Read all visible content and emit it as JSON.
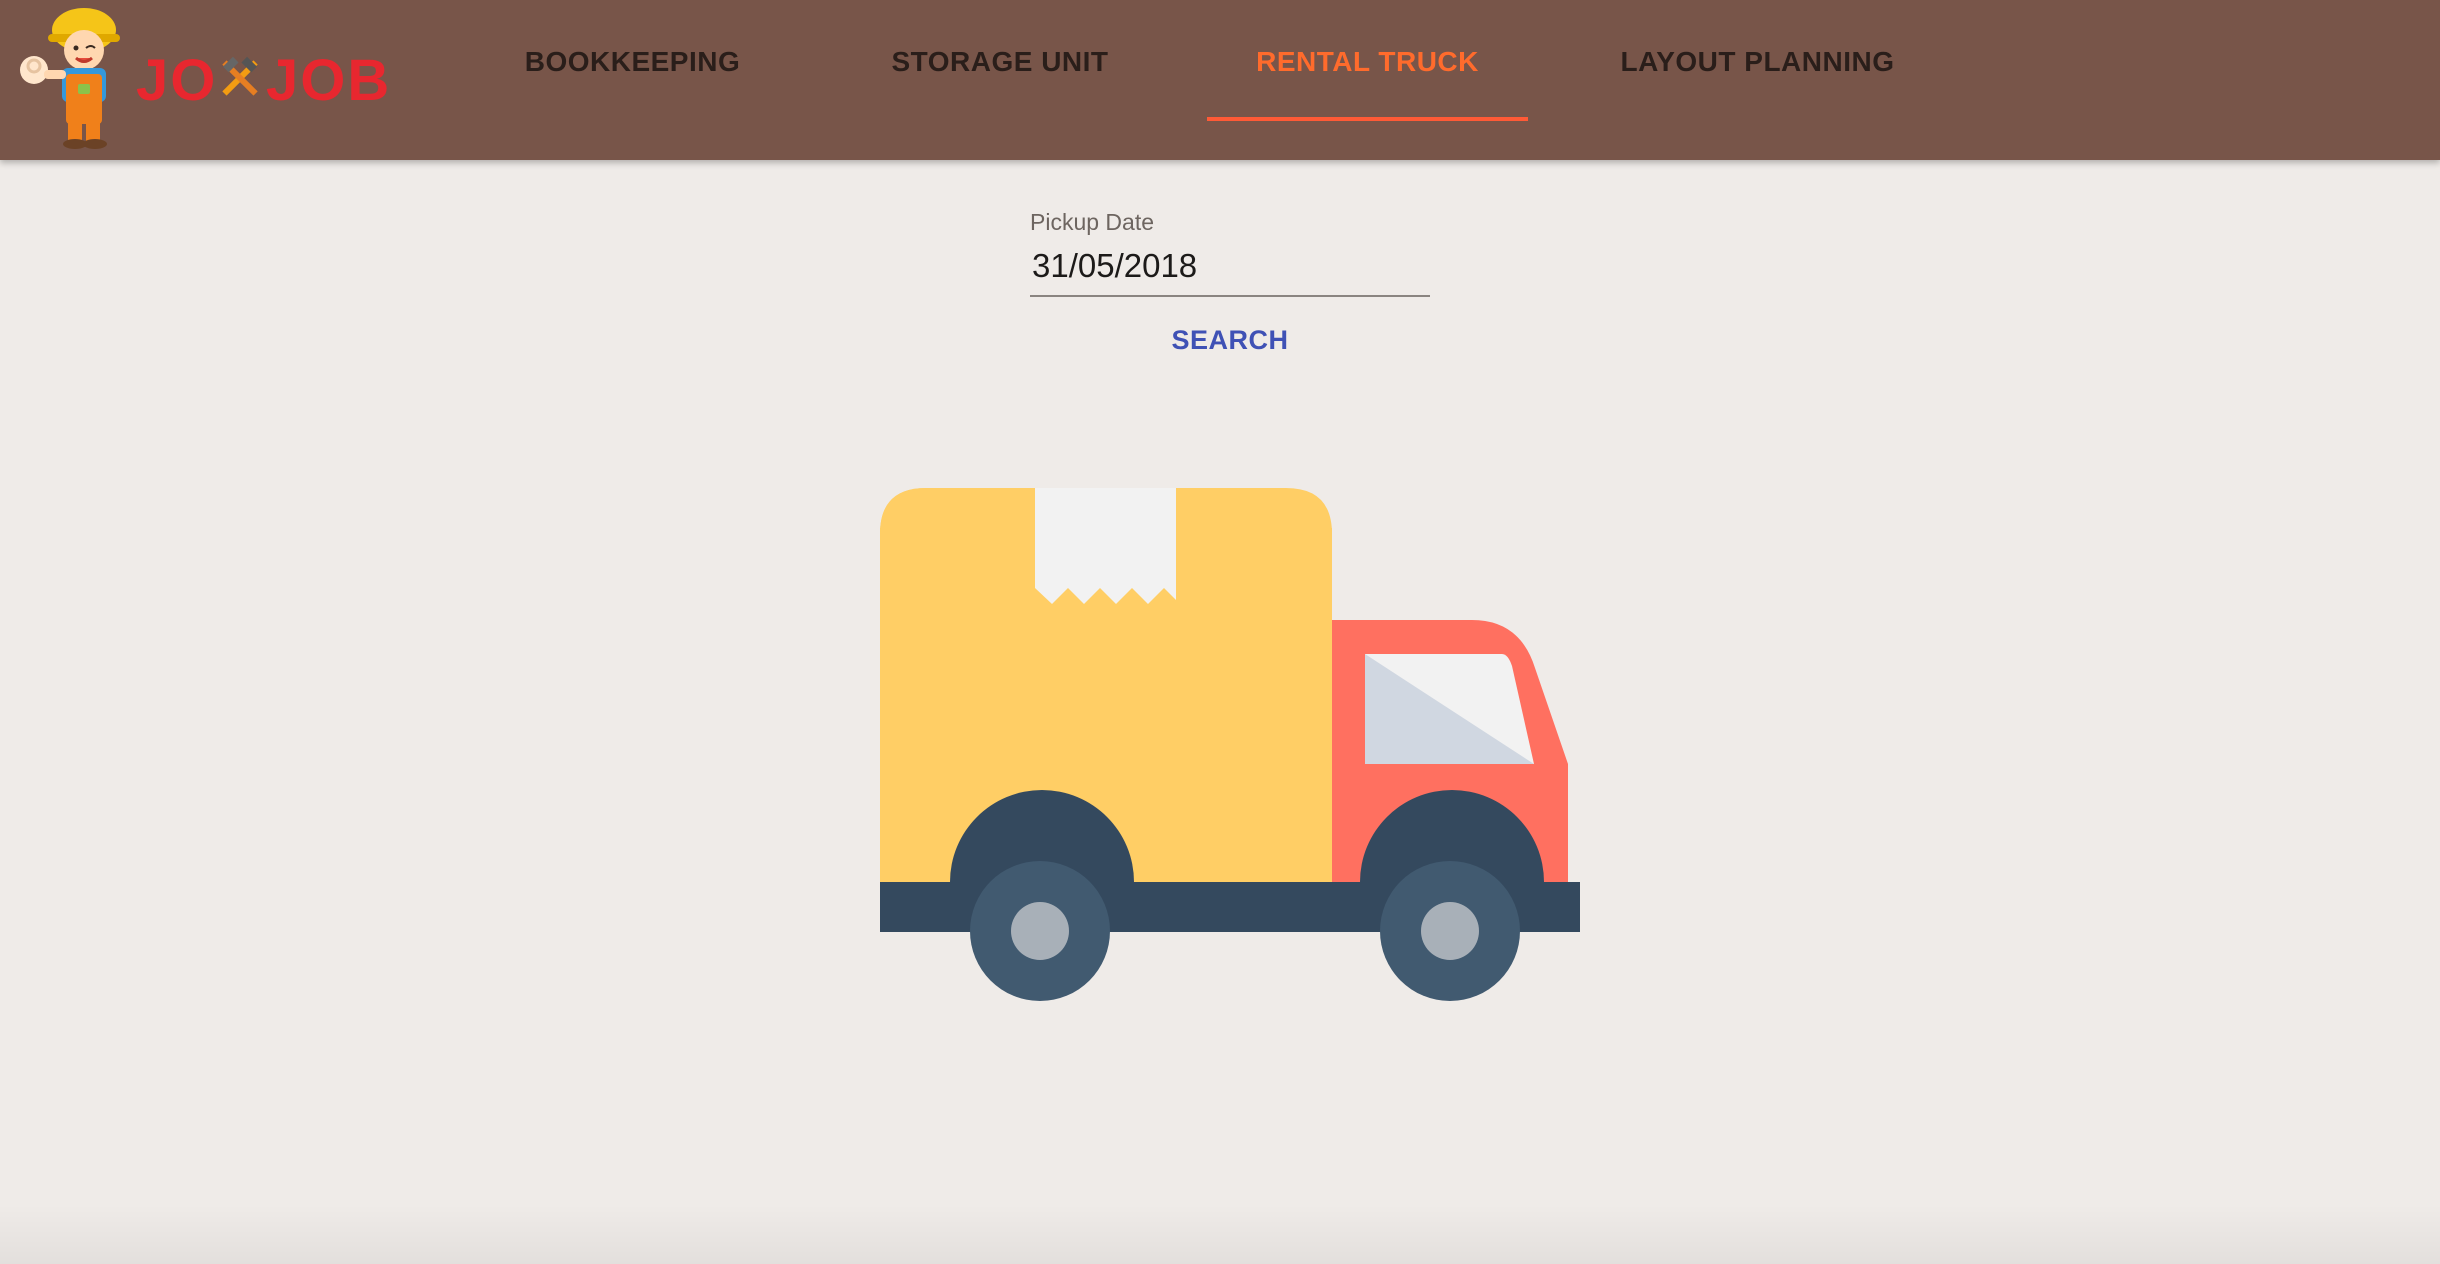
{
  "header": {
    "logo_text": "JO JOB",
    "tabs": [
      {
        "label": "BOOKKEEPING",
        "active": false
      },
      {
        "label": "STORAGE UNIT",
        "active": false
      },
      {
        "label": "RENTAL TRUCK",
        "active": true
      },
      {
        "label": "LAYOUT PLANNING",
        "active": false
      }
    ]
  },
  "form": {
    "pickup_date_label": "Pickup Date",
    "pickup_date_value": "31/05/2018",
    "search_label": "SEARCH"
  },
  "illustration": {
    "icon": "delivery-truck-icon"
  },
  "colors": {
    "appbar": "#785549",
    "background": "#efebe8",
    "active_tab": "#ff6b2c",
    "tab_indicator": "#ff5a36",
    "search_button": "#3f51b5",
    "logo_red": "#e8272f",
    "truck_box": "#ffce65",
    "truck_cab": "#ff7060",
    "truck_chassis": "#34495e",
    "truck_wheel": "#415a70"
  }
}
